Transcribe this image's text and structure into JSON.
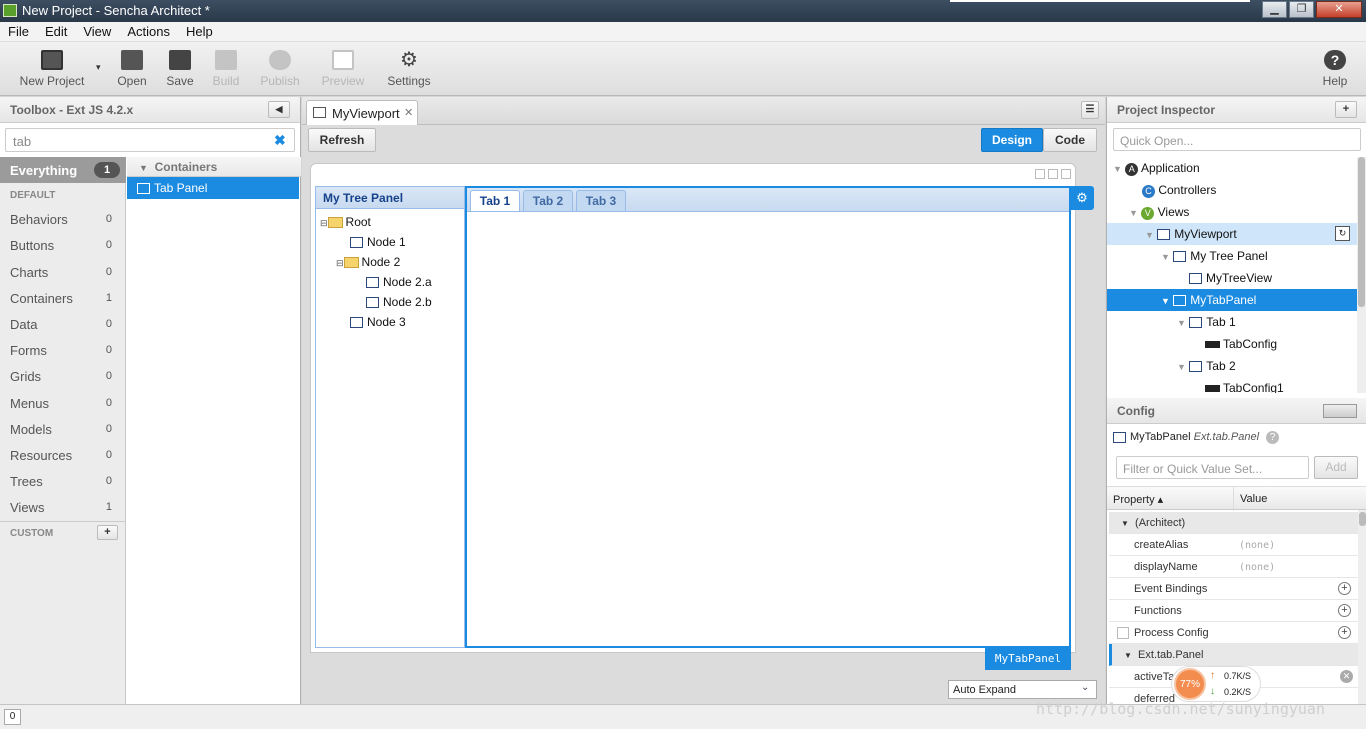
{
  "window": {
    "title": "New Project - Sencha Architect *"
  },
  "menu": [
    "File",
    "Edit",
    "View",
    "Actions",
    "Help"
  ],
  "toolbar": {
    "new_project": "New Project",
    "open": "Open",
    "save": "Save",
    "build": "Build",
    "publish": "Publish",
    "preview": "Preview",
    "settings": "Settings",
    "help": "Help"
  },
  "toolbox": {
    "title": "Toolbox - Ext JS 4.2.x",
    "search_value": "tab",
    "everything_label": "Everything",
    "everything_count": "1",
    "default_heading": "DEFAULT",
    "custom_heading": "CUSTOM",
    "categories": [
      {
        "label": "Behaviors",
        "count": "0"
      },
      {
        "label": "Buttons",
        "count": "0"
      },
      {
        "label": "Charts",
        "count": "0"
      },
      {
        "label": "Containers",
        "count": "1"
      },
      {
        "label": "Data",
        "count": "0"
      },
      {
        "label": "Forms",
        "count": "0"
      },
      {
        "label": "Grids",
        "count": "0"
      },
      {
        "label": "Menus",
        "count": "0"
      },
      {
        "label": "Models",
        "count": "0"
      },
      {
        "label": "Resources",
        "count": "0"
      },
      {
        "label": "Trees",
        "count": "0"
      },
      {
        "label": "Views",
        "count": "1"
      }
    ],
    "results_group": "Containers",
    "results_item": "Tab Panel"
  },
  "canvas": {
    "tab_label": "MyViewport",
    "refresh": "Refresh",
    "design": "Design",
    "code": "Code",
    "tree_panel_title": "My Tree Panel",
    "tree": {
      "root": "Root",
      "node1": "Node 1",
      "node2": "Node 2",
      "node2a": "Node 2.a",
      "node2b": "Node 2.b",
      "node3": "Node 3"
    },
    "tabs": [
      "Tab 1",
      "Tab 2",
      "Tab 3"
    ],
    "selected_component": "MyTabPanel",
    "auto_expand": "Auto Expand"
  },
  "inspector": {
    "title": "Project Inspector",
    "quick_open_placeholder": "Quick Open...",
    "items": {
      "application": "Application",
      "controllers": "Controllers",
      "views": "Views",
      "viewport": "MyViewport",
      "tree_panel": "My Tree Panel",
      "tree_view": "MyTreeView",
      "tab_panel": "MyTabPanel",
      "tab1": "Tab 1",
      "tabconfig": "TabConfig",
      "tab2": "Tab 2",
      "tabconfig1": "TabConfig1"
    }
  },
  "config": {
    "title": "Config",
    "component_name": "MyTabPanel",
    "component_class": "Ext.tab.Panel",
    "filter_placeholder": "Filter or Quick Value Set...",
    "add": "Add",
    "col_property": "Property ▴",
    "col_value": "Value",
    "group_architect": "(Architect)",
    "create_alias": "createAlias",
    "display_name": "displayName",
    "none": "(none)",
    "event_bindings": "Event Bindings",
    "functions": "Functions",
    "process_config": "Process Config",
    "group_ext": "Ext.tab.Panel",
    "active_tab": "activeTa",
    "deferred": "deferred"
  },
  "netmon": {
    "percent": "77%",
    "up": "0.7K/S",
    "down": "0.2K/S"
  },
  "status": {
    "count": "0"
  },
  "watermark": "http://blog.csdn.net/sunyingyuan"
}
